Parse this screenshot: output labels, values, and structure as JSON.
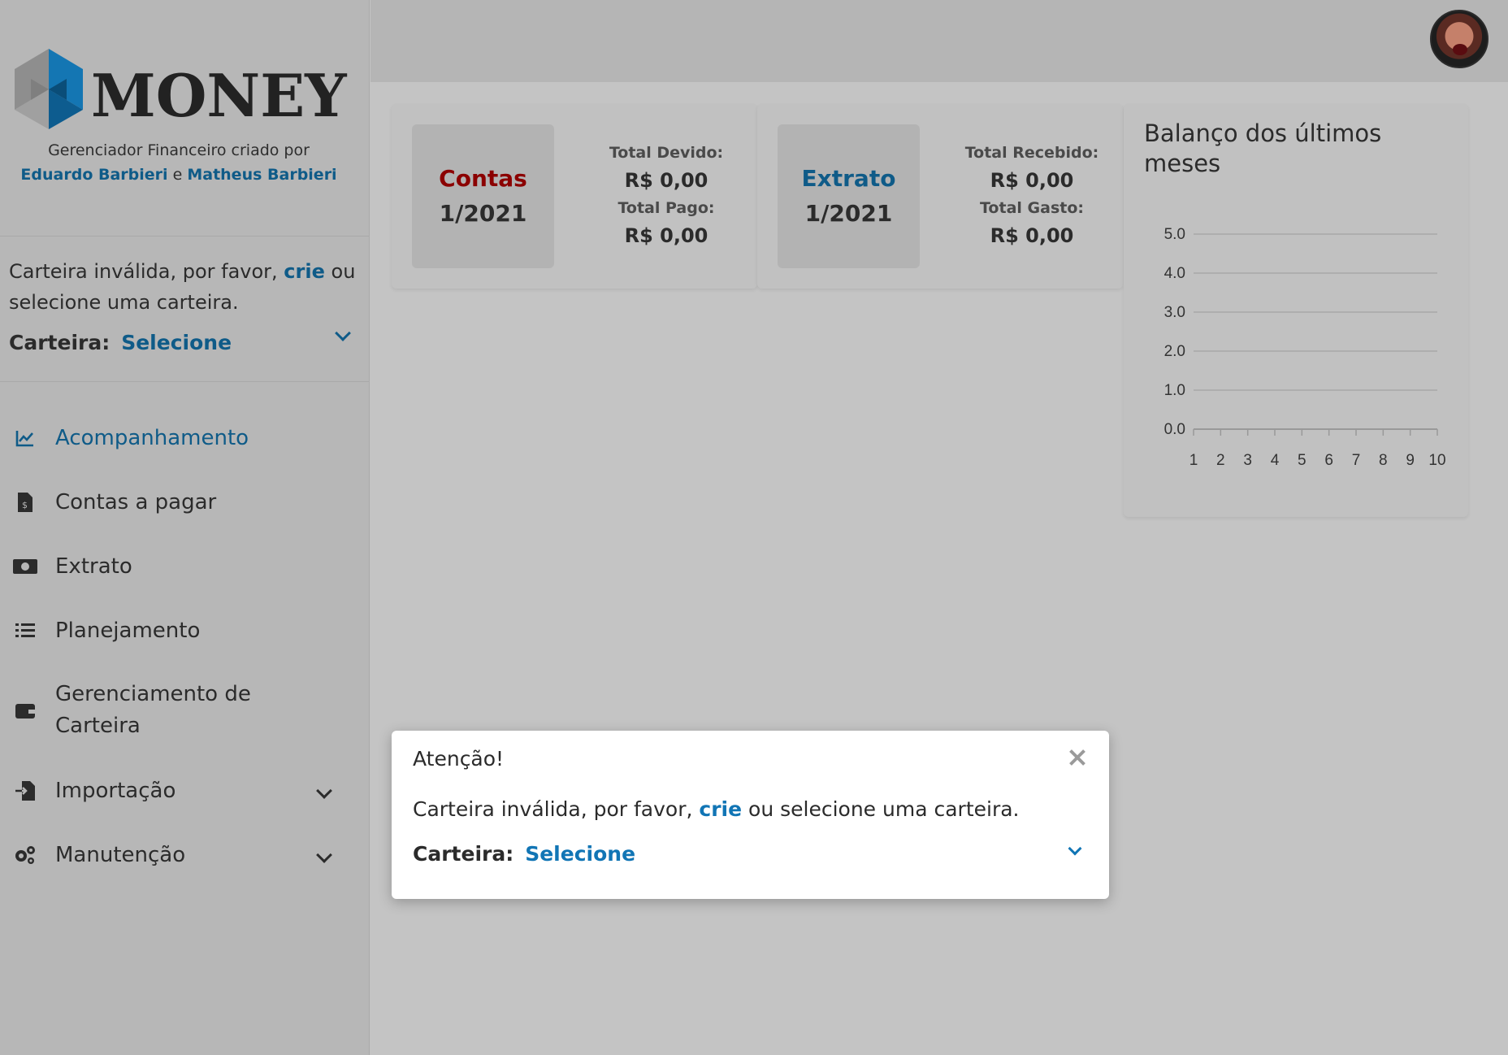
{
  "brand": {
    "logo_text": "MONEY",
    "caption_prefix": "Gerenciador Financeiro criado por",
    "author1": "Eduardo Barbieri",
    "conjunction": "e",
    "author2": "Matheus Barbieri"
  },
  "sidebar": {
    "wallet_msg_part1": "Carteira inválida, por favor,",
    "wallet_msg_link": "crie",
    "wallet_msg_part2": "ou selecione uma carteira.",
    "wallet_label": "Carteira:",
    "wallet_value": "Selecione",
    "nav": [
      {
        "label": "Acompanhamento",
        "icon": "chart-line-icon",
        "active": true
      },
      {
        "label": "Contas a pagar",
        "icon": "invoice-dollar-icon"
      },
      {
        "label": "Extrato",
        "icon": "money-bill-icon"
      },
      {
        "label": "Planejamento",
        "icon": "tasks-icon"
      },
      {
        "label": "Gerenciamento de Carteira",
        "icon": "wallet-icon"
      },
      {
        "label": "Importação",
        "icon": "file-import-icon",
        "expandable": true
      },
      {
        "label": "Manutenção",
        "icon": "cogs-icon",
        "expandable": true
      }
    ]
  },
  "cards": {
    "contas": {
      "title": "Contas",
      "period": "1/2021",
      "label1": "Total Devido:",
      "value1": "R$ 0,00",
      "label2": "Total Pago:",
      "value2": "R$ 0,00"
    },
    "extrato": {
      "title": "Extrato",
      "period": "1/2021",
      "label1": "Total Recebido:",
      "value1": "R$ 0,00",
      "label2": "Total Gasto:",
      "value2": "R$ 0,00"
    },
    "chart_title": "Balanço dos últimos meses"
  },
  "chart_data": {
    "type": "line",
    "title": "Balanço dos últimos meses",
    "x": [
      1,
      2,
      3,
      4,
      5,
      6,
      7,
      8,
      9,
      10
    ],
    "y_ticks": [
      "0.0",
      "1.0",
      "2.0",
      "3.0",
      "4.0",
      "5.0"
    ],
    "ylim": [
      0,
      5
    ],
    "series": [],
    "grid": true
  },
  "modal": {
    "title": "Atenção!",
    "msg_part1": "Carteira inválida, por favor,",
    "msg_link": "crie",
    "msg_part2": "ou selecione uma carteira.",
    "wallet_label": "Carteira:",
    "wallet_value": "Selecione"
  },
  "colors": {
    "brand_blue": "#0f5b88",
    "contas_red": "#8b0000",
    "link_blue": "#1175b5"
  }
}
